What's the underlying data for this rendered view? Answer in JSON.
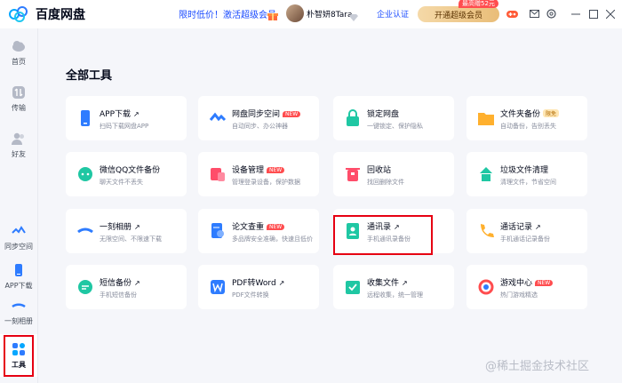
{
  "app": {
    "title": "百度网盘"
  },
  "header": {
    "promo": "限时低价！激活超级会员",
    "username": "朴智妍8Tara",
    "enterprise": "企业认证",
    "open_vip": "开通超级会员",
    "vip_badge": "最高赠52元"
  },
  "sidebar": {
    "items": [
      {
        "label": "首页",
        "icon": "home-icon"
      },
      {
        "label": "传输",
        "icon": "transfer-icon"
      },
      {
        "label": "好友",
        "icon": "friends-icon"
      },
      {
        "label": "同步空间",
        "icon": "sync-space-icon"
      },
      {
        "label": "APP下载",
        "icon": "app-download-icon"
      },
      {
        "label": "一刻相册",
        "icon": "album-icon"
      },
      {
        "label": "工具",
        "icon": "tools-icon",
        "active": true
      }
    ]
  },
  "main": {
    "title": "全部工具",
    "tools": [
      {
        "name": "APP下载",
        "desc": "扫码下载网盘APP",
        "tag": "arrow",
        "icon": "phone-icon",
        "color": "#2e7cff"
      },
      {
        "name": "网盘同步空间",
        "desc": "自动同步、办公神器",
        "tag": "new",
        "icon": "sync-icon",
        "color": "#2e7cff"
      },
      {
        "name": "锁定网盘",
        "desc": "一键锁定、保护隐私",
        "tag": "none",
        "icon": "lock-icon",
        "color": "#1fc7a3"
      },
      {
        "name": "文件夹备份",
        "desc": "自动备份，告别丢失",
        "tag": "beta",
        "tag_text": "限免",
        "icon": "folder-icon",
        "color": "#ffb02e"
      },
      {
        "name": "微信QQ文件备份",
        "desc": "聊天文件不丢失",
        "tag": "none",
        "icon": "chat-icon",
        "color": "#1fc7a3"
      },
      {
        "name": "设备管理",
        "desc": "管理登录设备，保护数据",
        "tag": "new",
        "icon": "device-icon",
        "color": "#ff4d6a"
      },
      {
        "name": "回收站",
        "desc": "找回删除文件",
        "tag": "none",
        "icon": "trash-icon",
        "color": "#ff4d6a"
      },
      {
        "name": "垃圾文件清理",
        "desc": "清理文件，节省空间",
        "tag": "none",
        "icon": "clean-icon",
        "color": "#1fc7a3"
      },
      {
        "name": "一刻相册",
        "desc": "无限空间、不限速下载",
        "tag": "arrow",
        "icon": "album-icon",
        "color": "#2e7cff"
      },
      {
        "name": "论文查重",
        "desc": "多品牌安全准确，快速且低价",
        "tag": "new",
        "icon": "paper-check-icon",
        "color": "#2e7cff"
      },
      {
        "name": "通讯录",
        "desc": "手机通讯录备份",
        "tag": "arrow",
        "icon": "contacts-icon",
        "color": "#1fc7a3"
      },
      {
        "name": "通话记录",
        "desc": "手机通话记录备份",
        "tag": "arrow",
        "icon": "phone-call-icon",
        "color": "#ffb02e"
      },
      {
        "name": "短信备份",
        "desc": "手机短信备份",
        "tag": "arrow",
        "icon": "sms-icon",
        "color": "#1fc7a3"
      },
      {
        "name": "PDF转Word",
        "desc": "PDF文件转换",
        "tag": "arrow",
        "icon": "word-icon",
        "color": "#2e7cff"
      },
      {
        "name": "收集文件",
        "desc": "远程收集，统一管理",
        "tag": "arrow",
        "icon": "collect-icon",
        "color": "#1fc7a3"
      },
      {
        "name": "游戏中心",
        "desc": "热门游戏精选",
        "tag": "new",
        "icon": "game-center-icon",
        "color": "#ff4d4f"
      }
    ]
  },
  "labels": {
    "new": "NEW",
    "arrow": "↗"
  },
  "watermark": "@稀土掘金技术社区"
}
